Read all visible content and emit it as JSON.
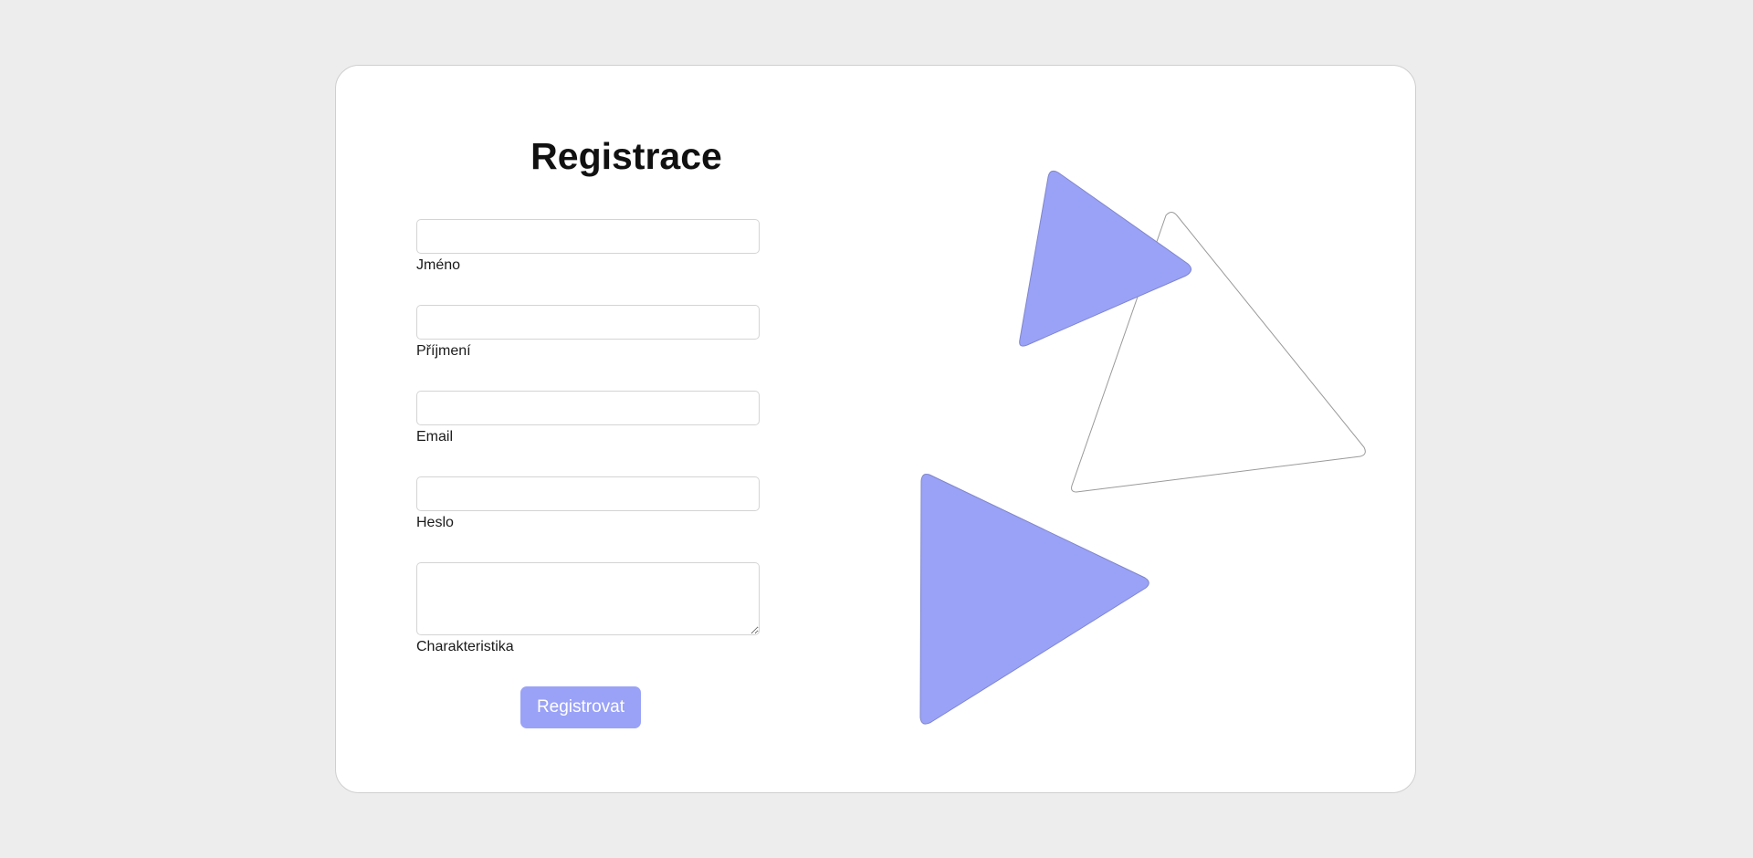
{
  "form": {
    "title": "Registrace",
    "fields": [
      {
        "label": "Jméno",
        "value": ""
      },
      {
        "label": "Příjmení",
        "value": ""
      },
      {
        "label": "Email",
        "value": ""
      },
      {
        "label": "Heslo",
        "value": ""
      },
      {
        "label": "Charakteristika",
        "value": ""
      }
    ],
    "submit_label": "Registrovat"
  },
  "colors": {
    "page_background": "#ededed",
    "card_background": "#ffffff",
    "accent": "#9aa2f7",
    "text": "#111111"
  },
  "decoration": {
    "shapes": [
      "filled-triangle",
      "outline-triangle",
      "filled-triangle"
    ]
  }
}
